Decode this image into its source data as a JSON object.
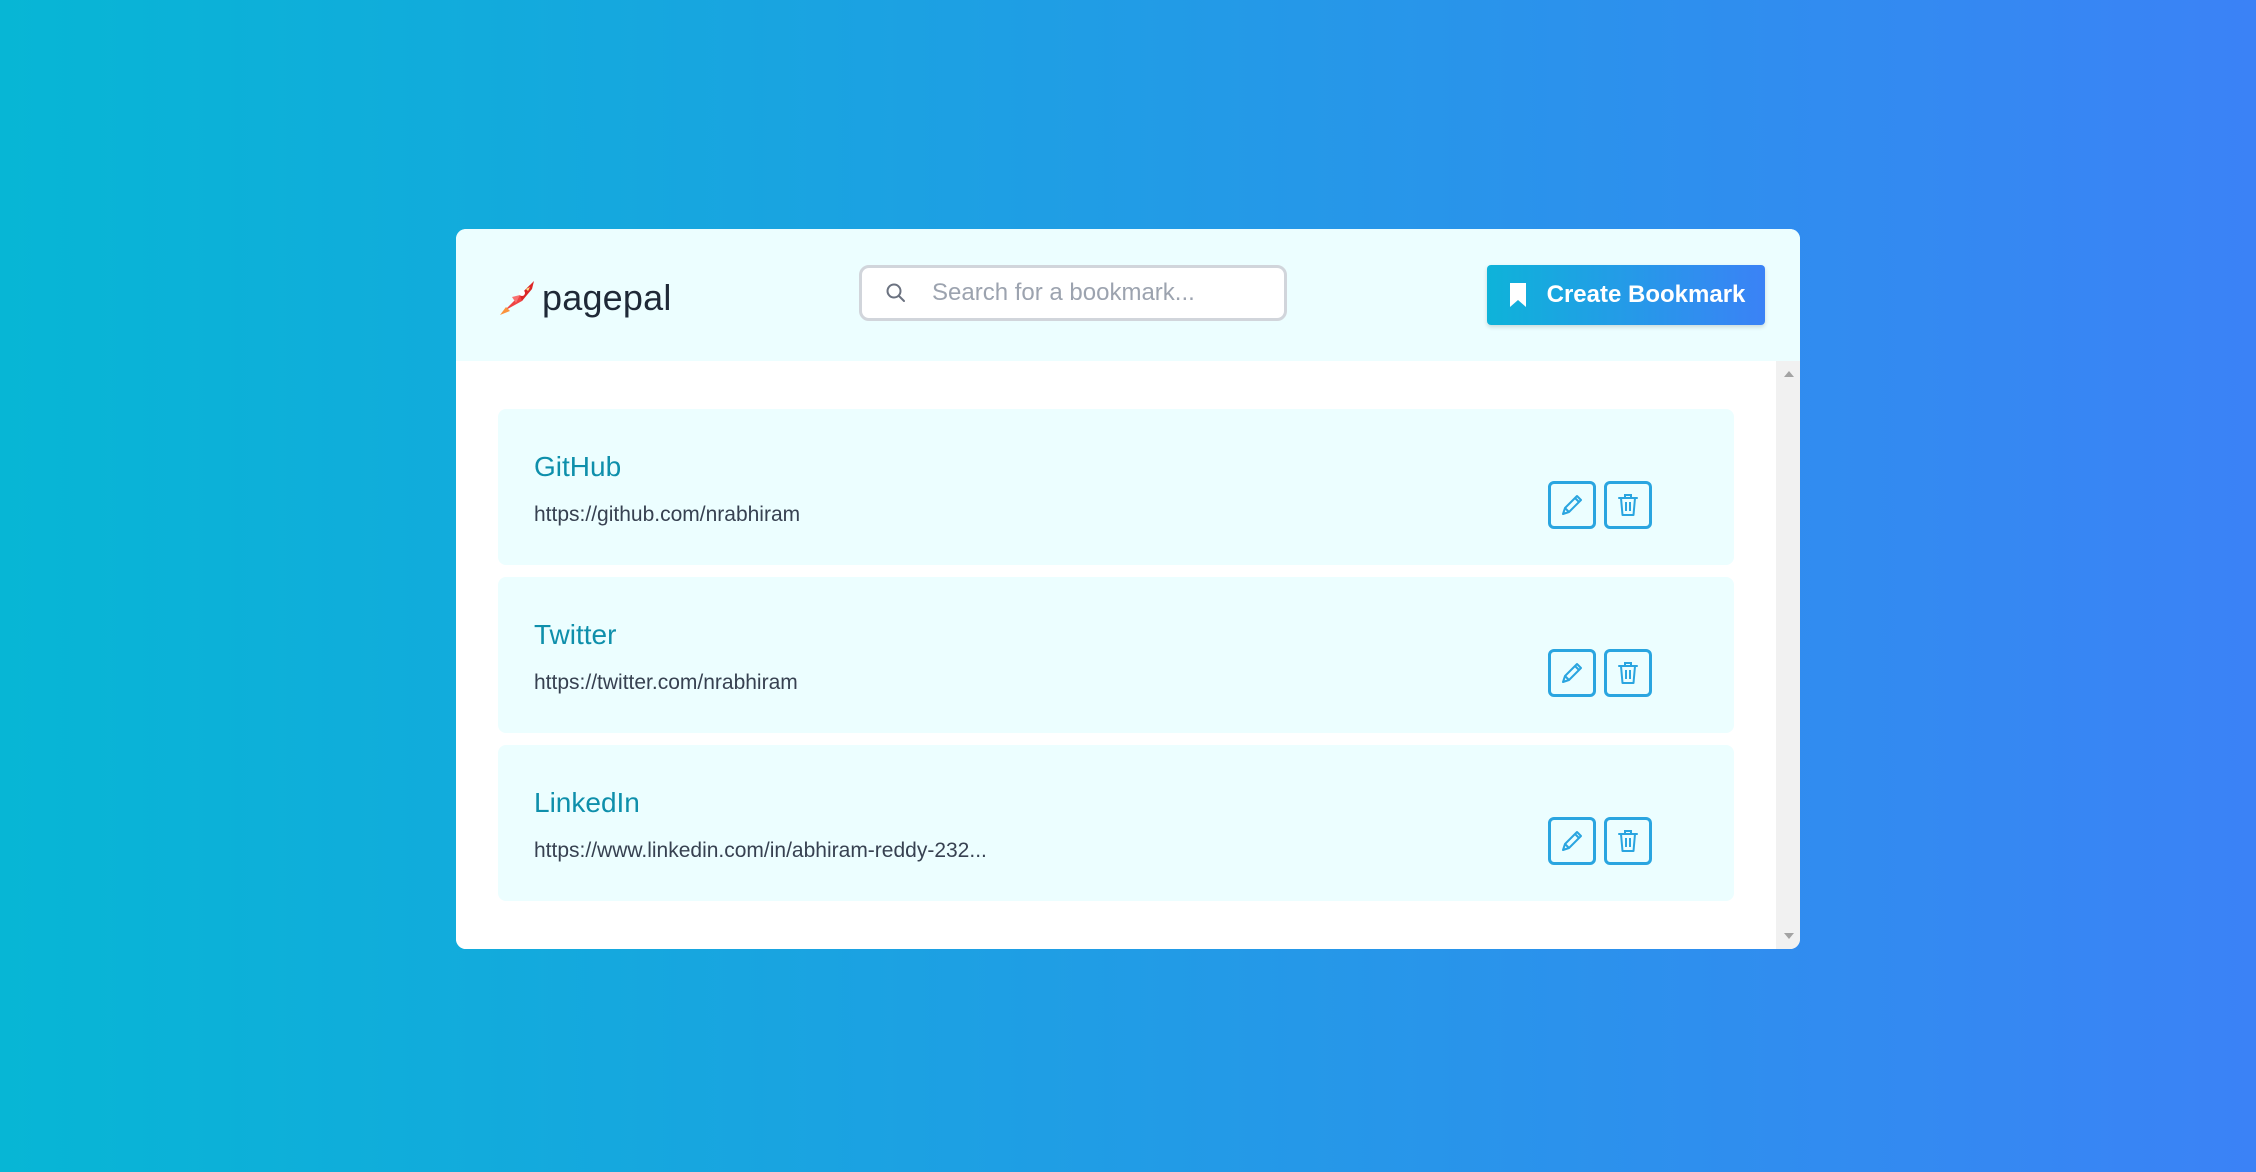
{
  "app": {
    "logo_text": "pagepal"
  },
  "search": {
    "placeholder": "Search for a bookmark..."
  },
  "header": {
    "create_label": "Create Bookmark"
  },
  "bookmarks": [
    {
      "title": "GitHub",
      "url": "https://github.com/nrabhiram"
    },
    {
      "title": "Twitter",
      "url": "https://twitter.com/nrabhiram"
    },
    {
      "title": "LinkedIn",
      "url": "https://www.linkedin.com/in/abhiram-reddy-232..."
    }
  ],
  "icons": {
    "logo": "rocket-icon",
    "search": "search-icon",
    "create": "bookmark-icon",
    "edit": "pencil-icon",
    "delete": "trash-icon"
  },
  "colors": {
    "background_start": "#07b6d5",
    "background_end": "#3b82f6",
    "header_bg": "#ecfeff",
    "card_bg": "#ecfeff",
    "title": "#0e8fab",
    "accent": "#2aa5e0"
  }
}
